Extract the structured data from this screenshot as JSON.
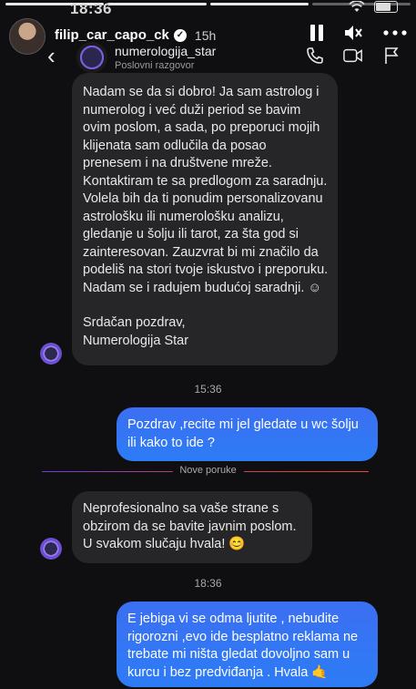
{
  "status_bar": {
    "time": "18:36"
  },
  "story": {
    "username": "filip_car_capo_ck",
    "verified_mark": "✓",
    "age": "15h",
    "icons": [
      "pause-icon",
      "mute-icon",
      "more-icon"
    ]
  },
  "chat": {
    "name": "numerologija_star",
    "subtitle": "Poslovni razgovor",
    "icons": [
      "back-icon",
      "phone-icon",
      "video-icon",
      "flag-icon"
    ]
  },
  "messages": {
    "first_incoming": {
      "paragraph1": "Nadam se da si dobro! Ja sam astrolog i numerolog i već duži period se bavim ovim poslom, a sada, po preporuci mojih klijenata sam odlučila da posao prenesem i na društvene mreže. Kontaktiram te sa predlogom za saradnju. Volela bih da ti ponudim personalizovanu astrološku ili numerološku analizu, gledanje u šolju ili tarot, za šta god si zainteresovan. Zauzvrat bi mi značilo da podeliš na stori tvoje iskustvo i preporuku. Nadam se i radujem budućoj saradnji. ☺",
      "signoff_line1": "Srdačan pozdrav,",
      "signoff_line2": "Numerologija Star"
    },
    "time1": "15:36",
    "first_outgoing": "Pozdrav ,recite mi jel gledate u wc šolju ili kako to ide ?",
    "divider_label": "Nove poruke",
    "second_incoming": "Neprofesionalno sa vaše strane s obzirom da se bavite javnim poslom. U svakom slučaju hvala! 😊",
    "time2": "18:36",
    "second_outgoing": "E jebiga vi se odma ljutite , nebudite rigorozni ,evo ide besplatno reklama ne trebate mi ništa gledat dovoljno sam u kurcu i bez predviđanja . Hvala 🤙"
  },
  "colors": {
    "background": "#0f0f11",
    "incoming_bubble": "#262629",
    "outgoing_bubble": "#3b6ff2",
    "divider_start": "#6b3fe0",
    "divider_end": "#e24b38"
  }
}
